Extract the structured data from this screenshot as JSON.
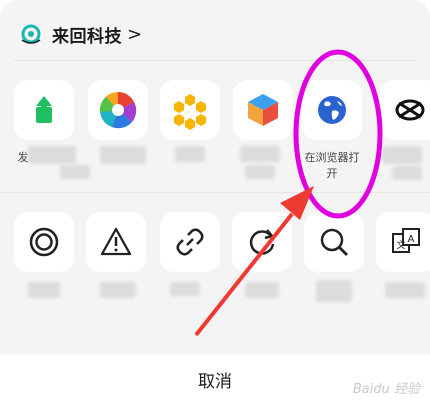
{
  "header": {
    "title": "来回科技",
    "chevron": ">"
  },
  "row1": [
    {
      "icon": "share-upload-icon",
      "label": "发"
    },
    {
      "icon": "photo-aperture-icon",
      "label": ""
    },
    {
      "icon": "honeycomb-app-icon",
      "label": ""
    },
    {
      "icon": "cube-app-icon",
      "label": ""
    },
    {
      "icon": "globe-browser-icon",
      "label_line1": "在浏览器打",
      "label_line2": "开"
    },
    {
      "icon": "fish-chat-icon",
      "label": ""
    }
  ],
  "row2": [
    {
      "icon": "target-circle-icon",
      "label": ""
    },
    {
      "icon": "warning-triangle-icon",
      "label": ""
    },
    {
      "icon": "link-chain-icon",
      "label": ""
    },
    {
      "icon": "refresh-icon",
      "label": ""
    },
    {
      "icon": "search-icon",
      "label": ""
    },
    {
      "icon": "translate-icon",
      "label": ""
    }
  ],
  "cancel_label": "取消",
  "watermark": "Baidu 经验",
  "colors": {
    "sheet": "#f4f4f4",
    "annotation": "#e000e0",
    "arrow": "#ef3a33",
    "globe": "#2a63cf"
  }
}
